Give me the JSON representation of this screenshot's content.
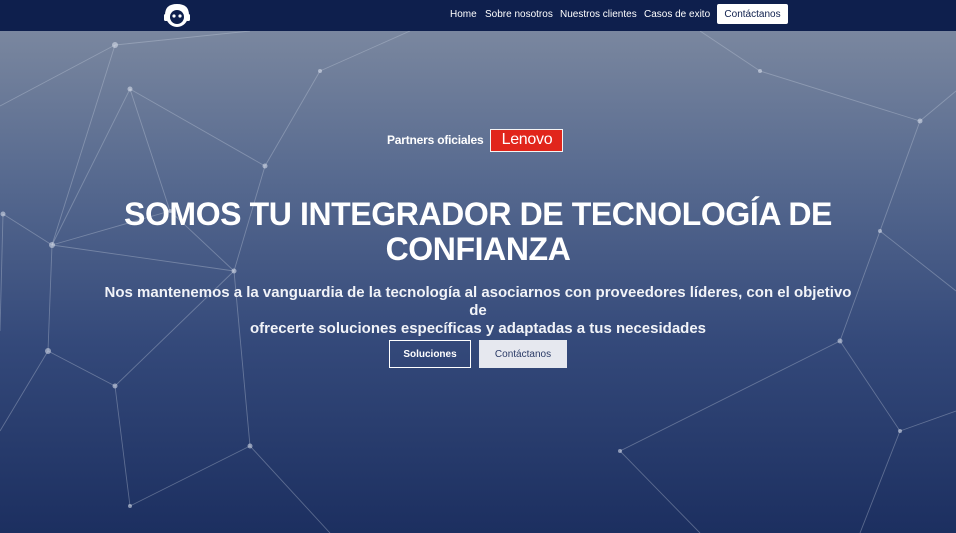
{
  "nav": {
    "logo_icon": "headset-avatar-icon",
    "links": [
      "Home",
      "Sobre nosotros",
      "Nuestros clientes",
      "Casos de exito"
    ],
    "cta": "Contáctanos"
  },
  "hero": {
    "partners_label": "Partners oficiales",
    "partner_logo_text": "Lenovo",
    "partner_color": "#e1251b",
    "title_line1": "SOMOS TU INTEGRADOR DE TECNOLOGÍA DE",
    "title_line2": "CONFIANZA",
    "subtitle_line1": "Nos mantenemos a la vanguardia de la tecnología al asociarnos con proveedores líderes, con el objetivo de",
    "subtitle_line2": "ofrecerte soluciones específicas y adaptadas a tus necesidades",
    "btn_primary": "Soluciones",
    "btn_secondary": "Contáctanos"
  },
  "colors": {
    "nav_bg": "#0e1f4d",
    "accent_red": "#e1251b"
  }
}
